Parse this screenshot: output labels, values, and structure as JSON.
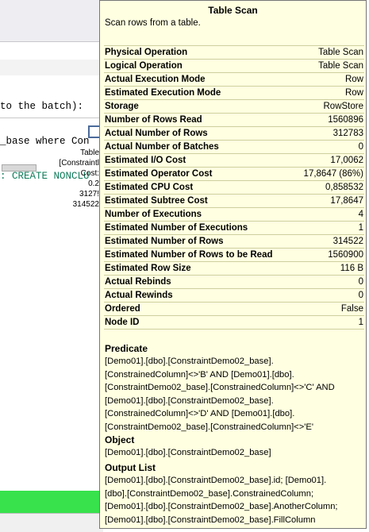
{
  "background": {
    "code_lines": [
      "to the batch):",
      "_base where Con",
      ": CREATE NONCLU"
    ],
    "plan_node_lines": [
      "Table",
      "[Constraintl",
      "Cost:",
      "0.2",
      "3127!",
      "314522"
    ]
  },
  "tooltip": {
    "title": "Table Scan",
    "description": "Scan rows from a table.",
    "properties": [
      {
        "label": "Physical Operation",
        "value": "Table Scan"
      },
      {
        "label": "Logical Operation",
        "value": "Table Scan"
      },
      {
        "label": "Actual Execution Mode",
        "value": "Row"
      },
      {
        "label": "Estimated Execution Mode",
        "value": "Row"
      },
      {
        "label": "Storage",
        "value": "RowStore"
      },
      {
        "label": "Number of Rows Read",
        "value": "1560896"
      },
      {
        "label": "Actual Number of Rows",
        "value": "312783"
      },
      {
        "label": "Actual Number of Batches",
        "value": "0"
      },
      {
        "label": "Estimated I/O Cost",
        "value": "17,0062"
      },
      {
        "label": "Estimated Operator Cost",
        "value": "17,8647 (86%)"
      },
      {
        "label": "Estimated CPU Cost",
        "value": "0,858532"
      },
      {
        "label": "Estimated Subtree Cost",
        "value": "17,8647"
      },
      {
        "label": "Number of Executions",
        "value": "4"
      },
      {
        "label": "Estimated Number of Executions",
        "value": "1"
      },
      {
        "label": "Estimated Number of Rows",
        "value": "314522"
      },
      {
        "label": "Estimated Number of Rows to be Read",
        "value": "1560900"
      },
      {
        "label": "Estimated Row Size",
        "value": "116 B"
      },
      {
        "label": "Actual Rebinds",
        "value": "0"
      },
      {
        "label": "Actual Rewinds",
        "value": "0"
      },
      {
        "label": "Ordered",
        "value": "False"
      },
      {
        "label": "Node ID",
        "value": "1"
      }
    ],
    "predicate": {
      "title": "Predicate",
      "text": "[Demo01].[dbo].[ConstraintDemo02_base].\n[ConstrainedColumn]<>'B' AND [Demo01].[dbo].\n[ConstraintDemo02_base].[ConstrainedColumn]<>'C' AND\n[Demo01].[dbo].[ConstraintDemo02_base].\n[ConstrainedColumn]<>'D' AND [Demo01].[dbo].\n[ConstraintDemo02_base].[ConstrainedColumn]<>'E'"
    },
    "object": {
      "title": "Object",
      "text": "[Demo01].[dbo].[ConstraintDemo02_base]"
    },
    "output_list": {
      "title": "Output List",
      "text": "[Demo01].[dbo].[ConstraintDemo02_base].id; [Demo01].\n[dbo].[ConstraintDemo02_base].ConstrainedColumn;\n[Demo01].[dbo].[ConstraintDemo02_base].AnotherColumn;\n[Demo01].[dbo].[ConstraintDemo02_base].FillColumn"
    }
  }
}
